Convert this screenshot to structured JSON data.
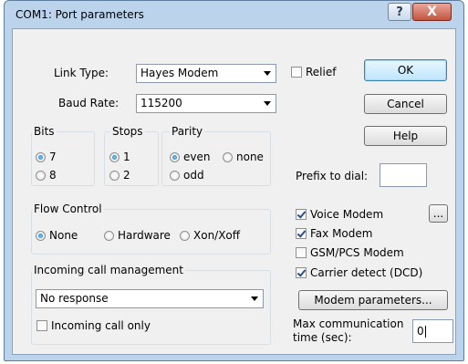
{
  "window": {
    "title": "COM1: Port parameters",
    "help_glyph": "?",
    "close_glyph": "X"
  },
  "form": {
    "link_type_label": "Link Type:",
    "link_type_value": "Hayes Modem",
    "baud_rate_label": "Baud Rate:",
    "baud_rate_value": "115200",
    "relief_label": "Relief",
    "relief_checked": false,
    "prefix_label": "Prefix to dial:",
    "prefix_value": ""
  },
  "buttons": {
    "ok": "OK",
    "cancel": "Cancel",
    "help": "Help",
    "ellipsis": "...",
    "modem_params": "Modem parameters..."
  },
  "bits": {
    "title": "Bits",
    "options": [
      "7",
      "8"
    ],
    "selected": "7"
  },
  "stops": {
    "title": "Stops",
    "options": [
      "1",
      "2"
    ],
    "selected": "1"
  },
  "parity": {
    "title": "Parity",
    "options": [
      "even",
      "none",
      "odd"
    ],
    "selected": "even"
  },
  "flow": {
    "title": "Flow Control",
    "options": [
      "None",
      "Hardware",
      "Xon/Xoff"
    ],
    "selected": "None"
  },
  "incoming": {
    "title": "Incoming call management",
    "response_value": "No response",
    "only_label": "Incoming call only",
    "only_checked": false
  },
  "modem": {
    "voice": "Voice Modem",
    "fax": "Fax Modem",
    "gsm": "GSM/PCS Modem",
    "carrier": "Carrier detect (DCD)",
    "voice_checked": true,
    "fax_checked": true,
    "gsm_checked": false,
    "carrier_checked": true
  },
  "maxtime": {
    "label_line1": "Max communication",
    "label_line2": "time (sec):",
    "value": "0"
  }
}
